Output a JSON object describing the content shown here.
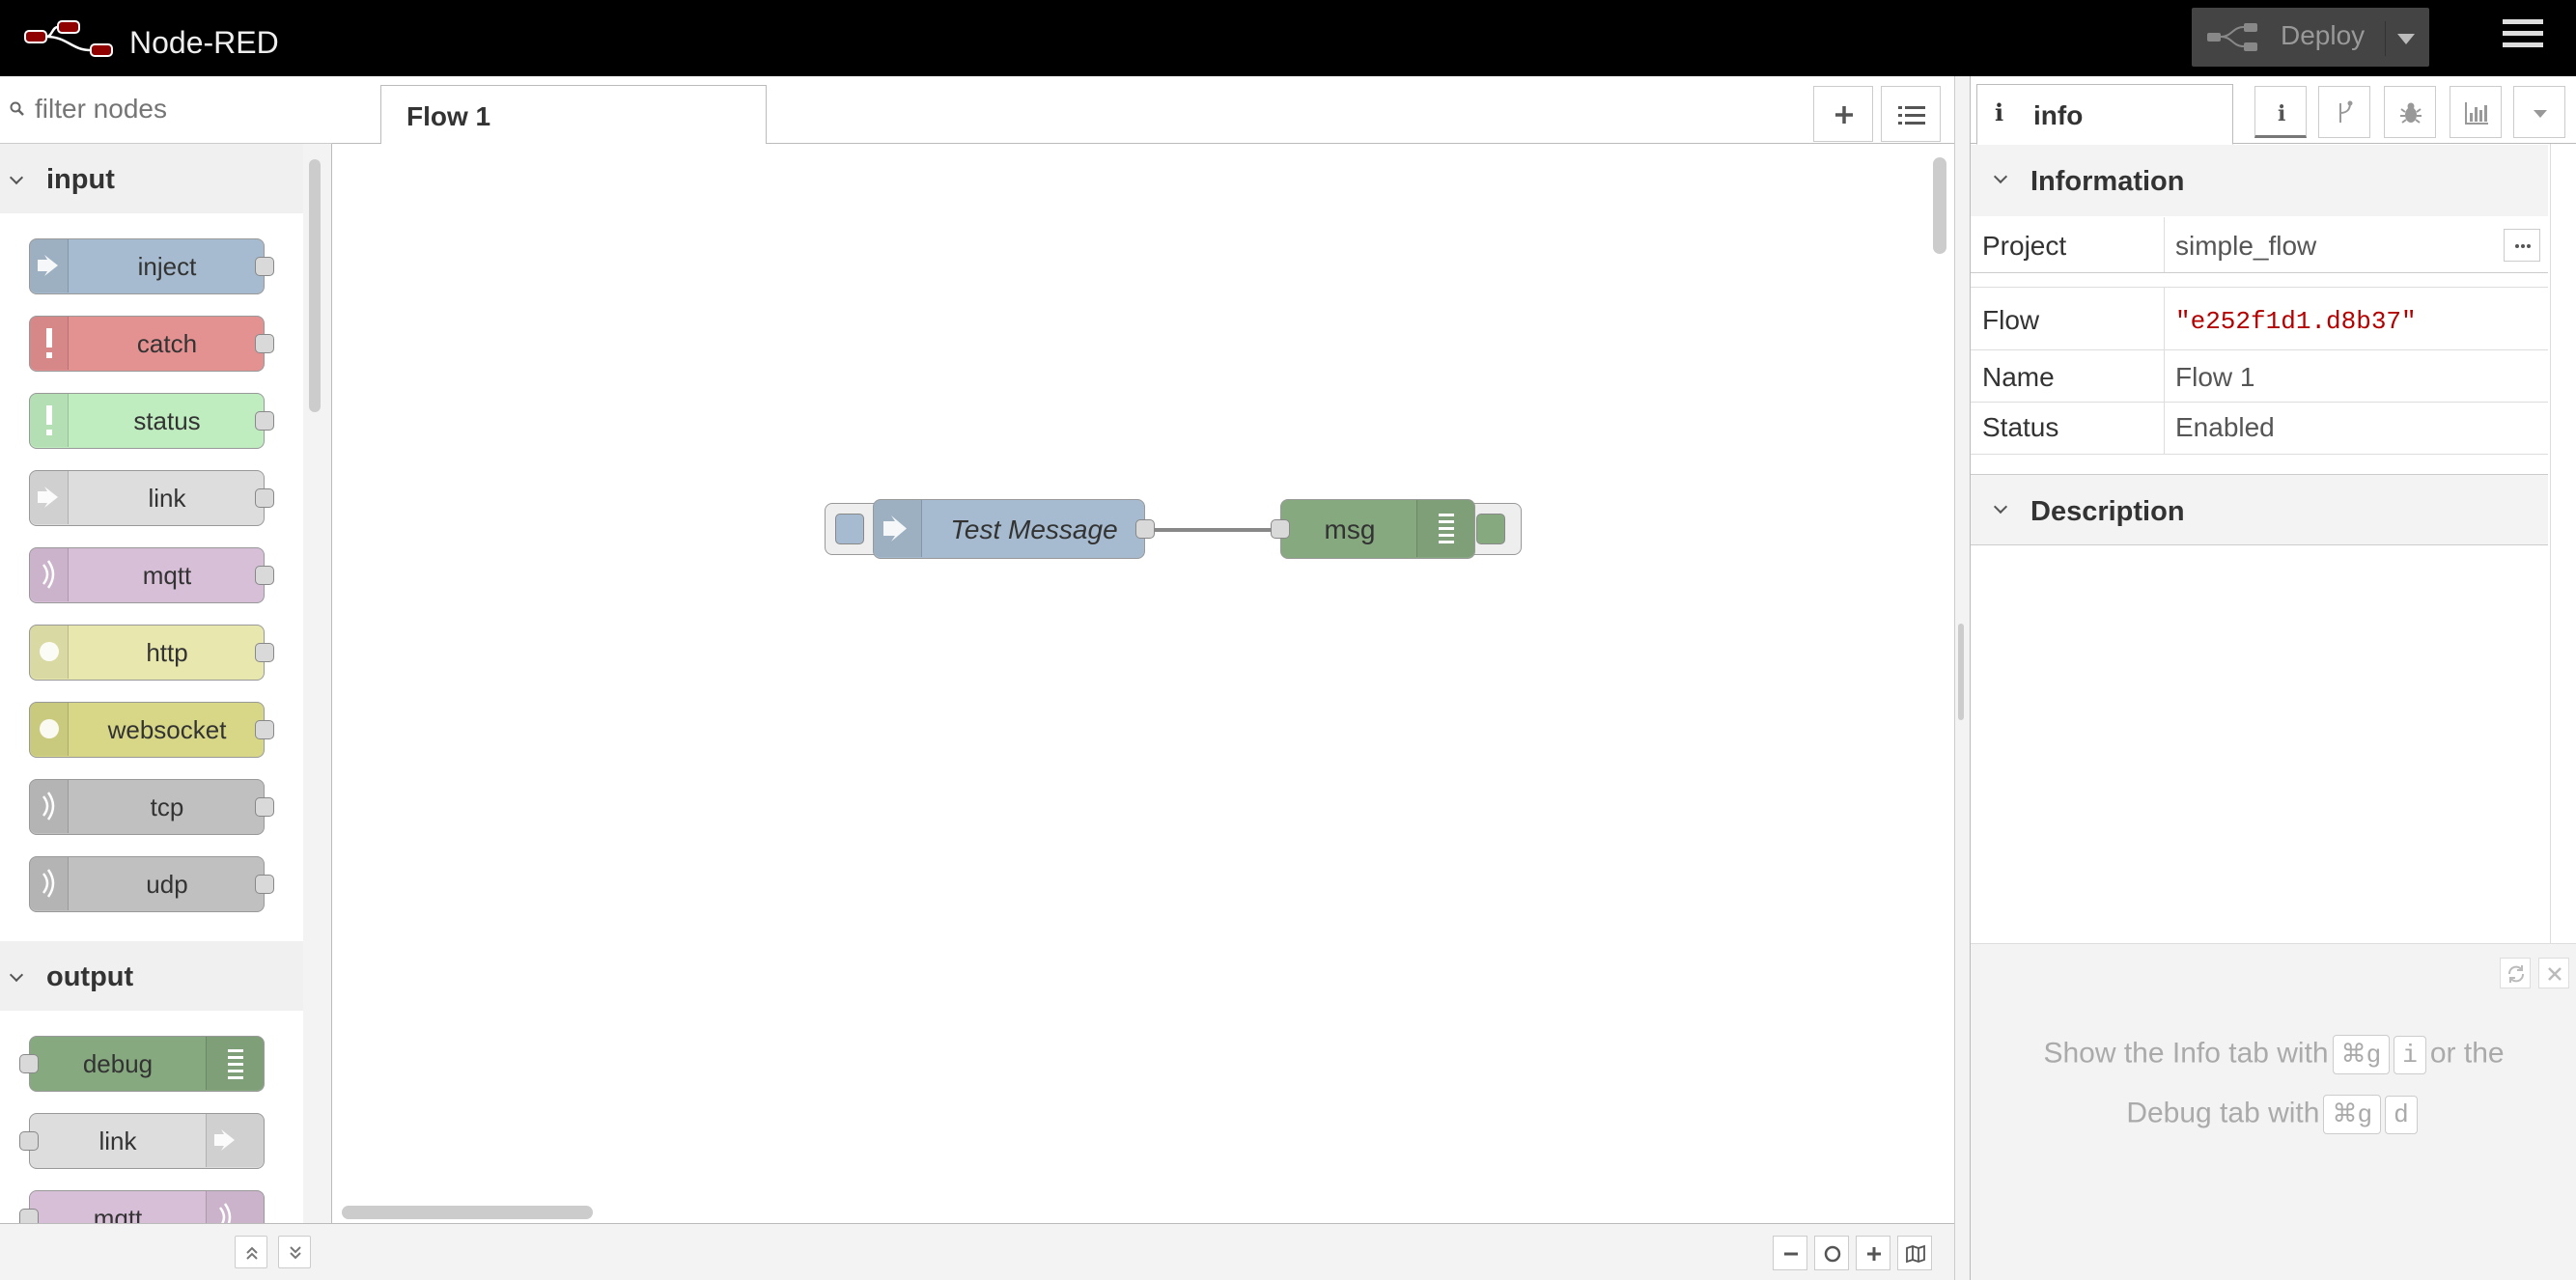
{
  "header": {
    "title": "Node-RED",
    "deploy_label": "Deploy"
  },
  "palette": {
    "search_placeholder": "filter nodes",
    "categories": [
      {
        "label": "input",
        "nodes": [
          {
            "label": "inject",
            "color": "#a6bbcf"
          },
          {
            "label": "catch",
            "color": "#e49191"
          },
          {
            "label": "status",
            "color": "#c0edc0"
          },
          {
            "label": "link",
            "color": "#dddddd"
          },
          {
            "label": "mqtt",
            "color": "#d8bfd8"
          },
          {
            "label": "http",
            "color": "#e7e7ae"
          },
          {
            "label": "websocket",
            "color": "#d7d787"
          },
          {
            "label": "tcp",
            "color": "#c0c0c0"
          },
          {
            "label": "udp",
            "color": "#c0c0c0"
          }
        ]
      },
      {
        "label": "output",
        "nodes": [
          {
            "label": "debug",
            "color": "#87a980"
          },
          {
            "label": "link",
            "color": "#dddddd"
          },
          {
            "label": "mqtt",
            "color": "#d8bfd8"
          }
        ]
      }
    ]
  },
  "workspace": {
    "tab_label": "Flow 1",
    "nodes": {
      "inject": {
        "label": "Test Message",
        "color": "#a6bbcf"
      },
      "debug": {
        "label": "msg",
        "color": "#87a980"
      }
    }
  },
  "sidebar": {
    "tab_icon": "i",
    "tab_label": "info",
    "info_header": "Information",
    "project_key": "Project",
    "project_value": "simple_flow",
    "flow_key": "Flow",
    "flow_value": "\"e252f1d1.d8b37\"",
    "name_key": "Name",
    "name_value": "Flow 1",
    "status_key": "Status",
    "status_value": "Enabled",
    "description_header": "Description",
    "tips": {
      "line1_prefix": "Show the Info tab with",
      "line1_key1": "⌘g",
      "line1_key2": "i",
      "line1_suffix": "or the",
      "line2_prefix": "Debug tab with",
      "line2_key1": "⌘g",
      "line2_key2": "d"
    }
  }
}
